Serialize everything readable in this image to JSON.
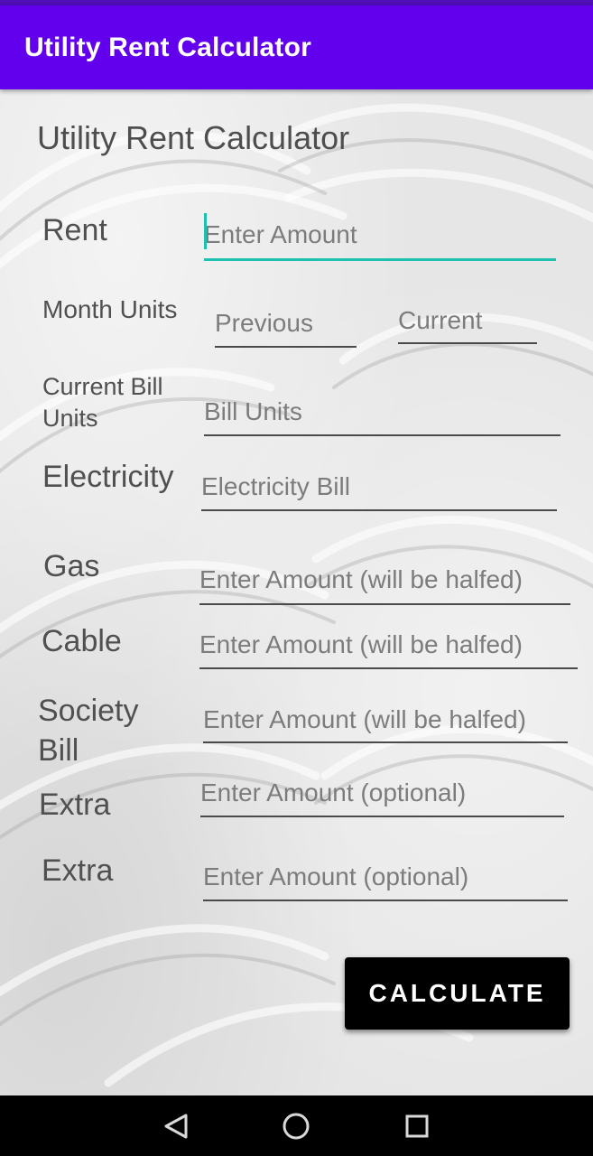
{
  "app_bar": {
    "title": "Utility Rent Calculator"
  },
  "form": {
    "heading": "Utility Rent Calculator",
    "rent": {
      "label": "Rent",
      "placeholder": "Enter Amount"
    },
    "month_units": {
      "label": "Month Units",
      "previous_placeholder": "Previous",
      "current_placeholder": "Current"
    },
    "bill_units": {
      "label_line1": "Current Bill",
      "label_line2": "Units",
      "placeholder": "Bill Units"
    },
    "electricity": {
      "label": "Electricity",
      "placeholder": "Electricity Bill"
    },
    "gas": {
      "label": "Gas",
      "placeholder": "Enter Amount (will be halfed)"
    },
    "cable": {
      "label": "Cable",
      "placeholder": "Enter Amount (will be halfed)"
    },
    "society": {
      "label_line1": "Society",
      "label_line2": "Bill",
      "placeholder": "Enter Amount (will be halfed)"
    },
    "extra1": {
      "label": "Extra",
      "placeholder": "Enter Amount (optional)"
    },
    "extra2": {
      "label": "Extra",
      "placeholder": "Enter Amount (optional)"
    }
  },
  "calculate_button": {
    "label": "CALCULATE"
  },
  "nav": {
    "back_icon": "back-triangle-icon",
    "home_icon": "home-circle-icon",
    "recents_icon": "recents-square-icon"
  },
  "colors": {
    "app_bar": "#6200ee",
    "status_bar": "#4f10b5",
    "focus_accent": "#1fc0b0",
    "button": "#000000"
  }
}
